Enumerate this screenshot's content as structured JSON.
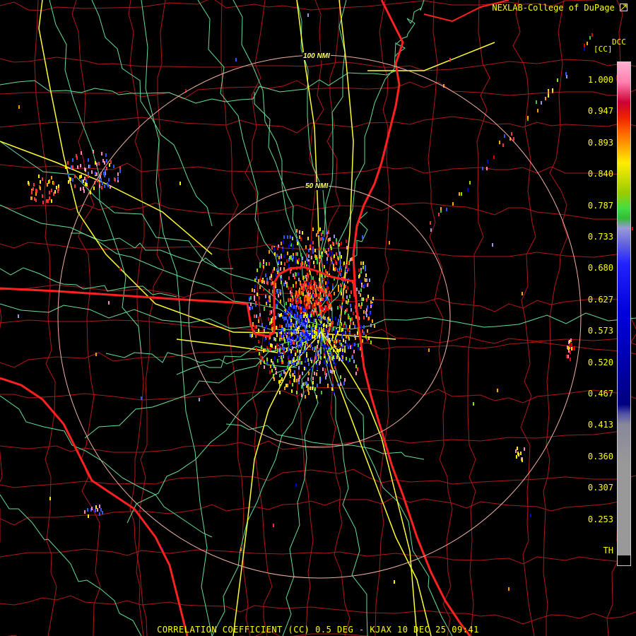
{
  "header": {
    "credit": "NEXLAB-College of DuPage",
    "credit_icon": "nexlab-logo-icon"
  },
  "map": {
    "radar_site": "KJAX",
    "range_rings": [
      {
        "label": "50 NMI"
      },
      {
        "label": "100 NMI"
      }
    ],
    "colors": {
      "state_border": "#ff2020",
      "county_border": "#b01818",
      "highway": "#ffff33",
      "road": "#66dd99",
      "range_ring": "#f0b0a0",
      "coastline": "#ff2020"
    }
  },
  "legend": {
    "product_code": "DCC",
    "unit": "[CC]",
    "ticks": [
      "1.000",
      "0.947",
      "0.893",
      "0.840",
      "0.787",
      "0.733",
      "0.680",
      "0.627",
      "0.573",
      "0.520",
      "0.467",
      "0.413",
      "0.360",
      "0.307",
      "0.253",
      "TH"
    ],
    "scale": [
      {
        "value": "1.000",
        "color": "#ff99cc"
      },
      {
        "value": "0.947",
        "color": "#e00030"
      },
      {
        "value": "0.893",
        "color": "#ff8800"
      },
      {
        "value": "0.840",
        "color": "#ccdd00"
      },
      {
        "value": "0.787",
        "color": "#33cc33"
      },
      {
        "value": "0.733",
        "color": "#8888dd"
      },
      {
        "value": "0.680",
        "color": "#1a1aff"
      },
      {
        "value": "0.627",
        "color": "#0000cc"
      },
      {
        "value": "0.573",
        "color": "#000099"
      },
      {
        "value": "0.520",
        "color": "#00007a"
      },
      {
        "value": "0.467",
        "color": "#000070"
      },
      {
        "value": "0.413",
        "color": "#999999"
      },
      {
        "value": "0.360",
        "color": "#999999"
      },
      {
        "value": "0.307",
        "color": "#999999"
      },
      {
        "value": "0.253",
        "color": "#999999"
      },
      {
        "value": "TH",
        "color": "#000000"
      }
    ]
  },
  "footer": {
    "caption": "CORRELATION COEFFICIENT (CC) 0.5 DEG - KJAX 10 DEC 25 09:41"
  }
}
